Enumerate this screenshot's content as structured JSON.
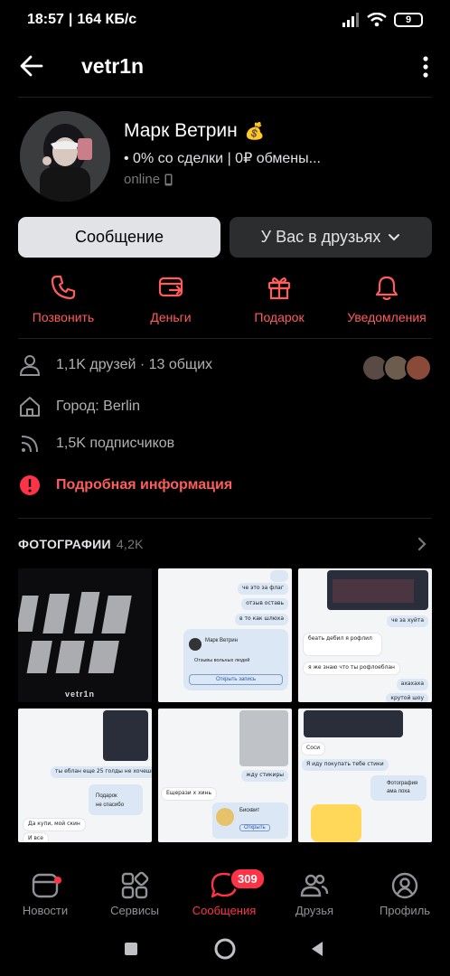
{
  "status_bar": {
    "time": "18:57",
    "net_speed": "164 КБ/с",
    "battery": "9"
  },
  "header": {
    "title": "vetr1n"
  },
  "profile": {
    "name": "Марк Ветрин",
    "name_emoji": "💰",
    "status": "• 0% со сделки | 0₽ обмены...",
    "online": "online"
  },
  "buttons": {
    "message": "Сообщение",
    "friends": "У Вас в друзьях"
  },
  "actions": [
    {
      "label": "Позвонить",
      "icon": "phone-icon"
    },
    {
      "label": "Деньги",
      "icon": "money-transfer-icon"
    },
    {
      "label": "Подарок",
      "icon": "gift-icon"
    },
    {
      "label": "Уведомления",
      "icon": "bell-icon"
    }
  ],
  "info": {
    "friends": "1,1K друзей · 13 общих",
    "city": "Город: Berlin",
    "followers": "1,5K подписчиков",
    "details": "Подробная информация"
  },
  "photos": {
    "title": "ФОТОГРАФИИ",
    "count": "4,2K",
    "tile1_text": "vetr1n"
  },
  "chat_snippets": {
    "t2a": "че это за флаг",
    "t2b": "отзыв оставь",
    "t2c": "в то как шлюха",
    "t2d": "Марк Ветрин",
    "t2e": "Отзывы вольных людей",
    "t2f": "Открыть запись",
    "t3a": "че за хуйта",
    "t3b": "беать дебил я рофлил",
    "t3c": "я же знаю что ты рофлоеблан",
    "t3d": "ахахаха",
    "t3e": "крутой шоу",
    "t4a": "ты еблан еще 25 голды не хочешь",
    "t4b": "Подарок",
    "t4c": "не спасибо",
    "t4d": "Да купи, мой скин",
    "t4e": "И все",
    "t5a": "жду стикиры",
    "t5b": "Ещерази х хинь",
    "t5c": "Бисквит",
    "t5d": "Открыть",
    "t6a": "Соси",
    "t6b": "Я иду покупать тебе стики",
    "t6c": "Фотография",
    "t6d": "ама лоха"
  },
  "bottom_nav": [
    {
      "label": "Новости",
      "icon": "news-icon"
    },
    {
      "label": "Сервисы",
      "icon": "services-icon"
    },
    {
      "label": "Сообщения",
      "icon": "messages-icon",
      "badge": "309"
    },
    {
      "label": "Друзья",
      "icon": "friends-icon"
    },
    {
      "label": "Профиль",
      "icon": "profile-icon"
    }
  ],
  "colors": {
    "accent": "#ff3347",
    "action_red": "#ff5c5c",
    "bg": "#000000",
    "secondary": "#2c2d2e"
  }
}
